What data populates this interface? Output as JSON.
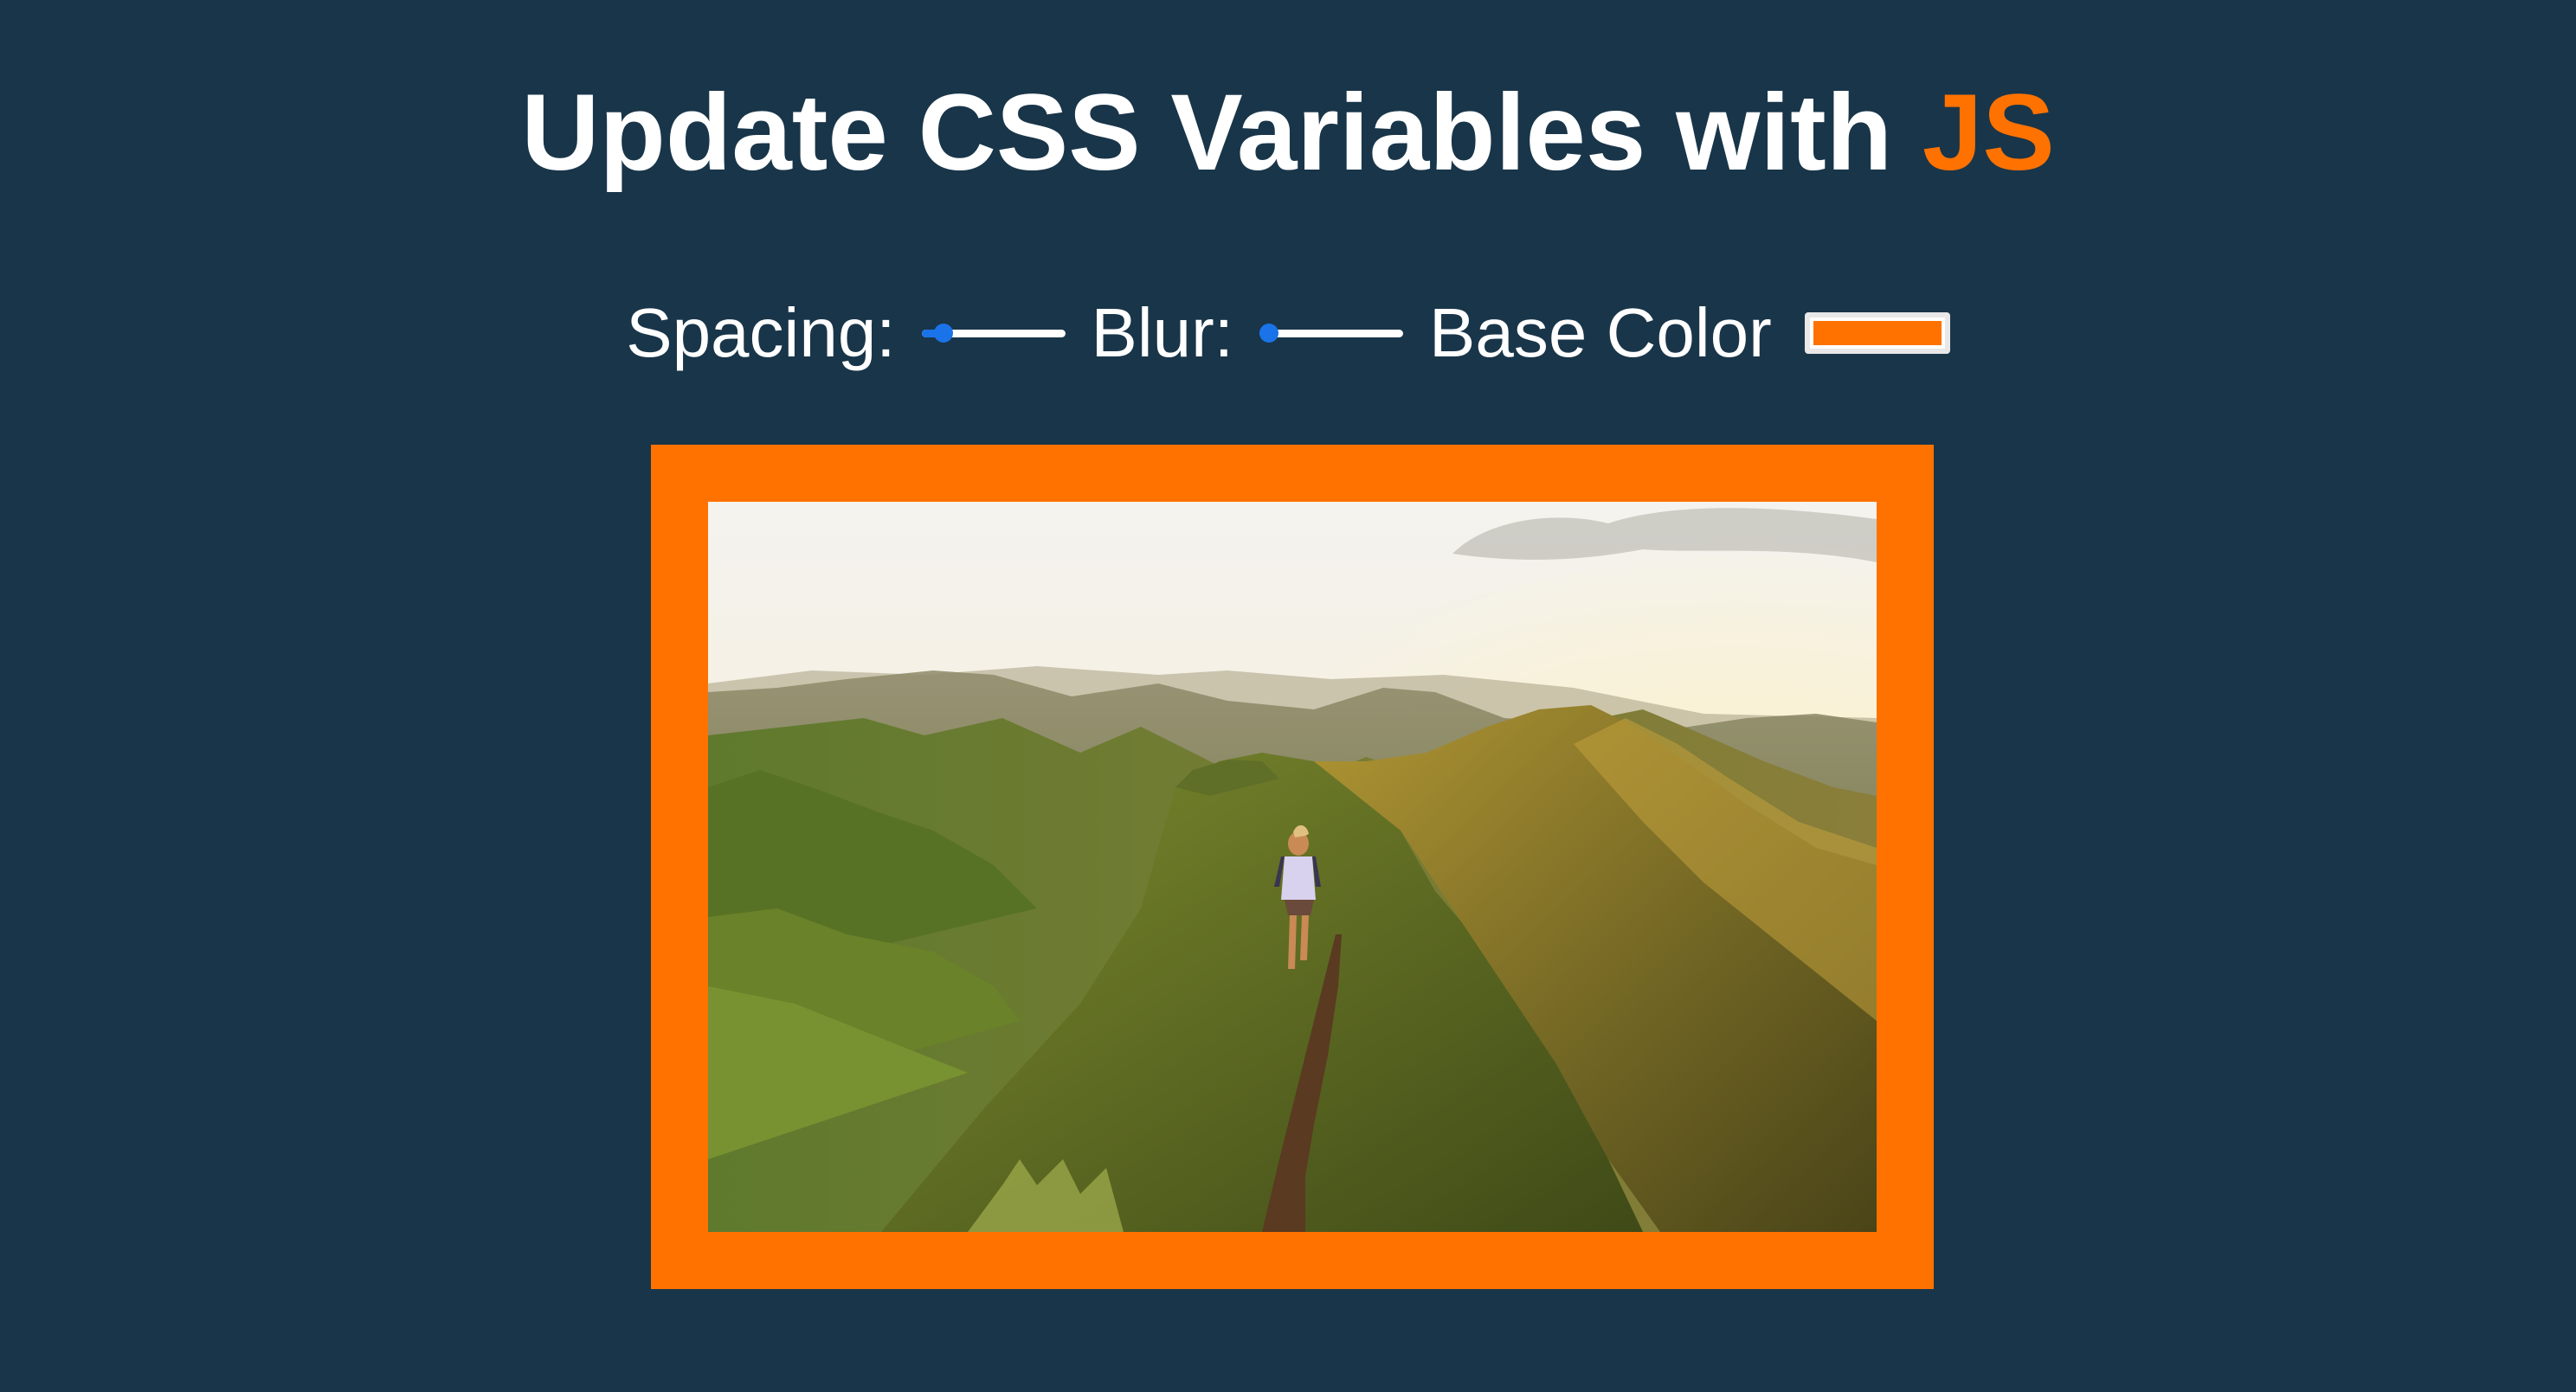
{
  "header": {
    "title_prefix": "Update CSS Variables with ",
    "title_highlight": "JS"
  },
  "controls": {
    "spacing_label": "Spacing:",
    "spacing_value": 10,
    "blur_label": "Blur:",
    "blur_value": 0,
    "base_color_label": "Base Color",
    "base_color_value": "#ff7200"
  },
  "colors": {
    "background": "#193549",
    "accent": "#ff7200",
    "slider_accent": "#1a73e8"
  },
  "image": {
    "icon": "mountain-ridge-hiker-photo"
  }
}
